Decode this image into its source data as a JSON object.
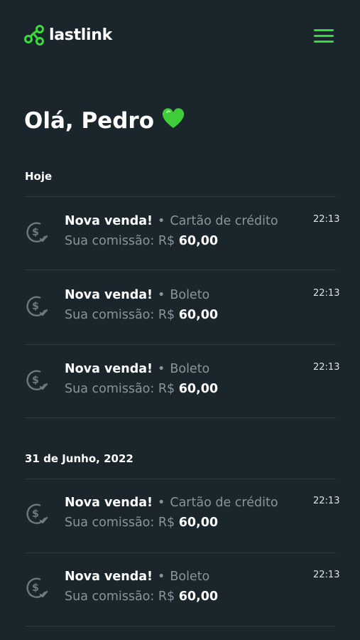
{
  "brand": {
    "name": "lastlink",
    "accent": "#3bd93b"
  },
  "greeting": {
    "text": "Olá, Pedro",
    "emoji": "green-heart-icon"
  },
  "sections": [
    {
      "label": "Hoje",
      "items": [
        {
          "title": "Nova venda!",
          "method": "Cartão de crédito",
          "commission_label": "Sua comissão: R$",
          "amount": "60,00",
          "time": "22:13"
        },
        {
          "title": "Nova venda!",
          "method": "Boleto",
          "commission_label": "Sua comissão: R$",
          "amount": "60,00",
          "time": "22:13"
        },
        {
          "title": "Nova venda!",
          "method": "Boleto",
          "commission_label": "Sua comissão: R$",
          "amount": "60,00",
          "time": "22:13"
        }
      ]
    },
    {
      "label": "31 de Junho, 2022",
      "items": [
        {
          "title": "Nova venda!",
          "method": "Cartão de crédito",
          "commission_label": "Sua comissão: R$",
          "amount": "60,00",
          "time": "22:13"
        },
        {
          "title": "Nova venda!",
          "method": "Boleto",
          "commission_label": "Sua comissão: R$",
          "amount": "60,00",
          "time": "22:13"
        }
      ]
    }
  ],
  "separator": "•",
  "colors": {
    "background": "#1b262c",
    "muted_text": "#8a949b",
    "divider": "#2c3942"
  }
}
